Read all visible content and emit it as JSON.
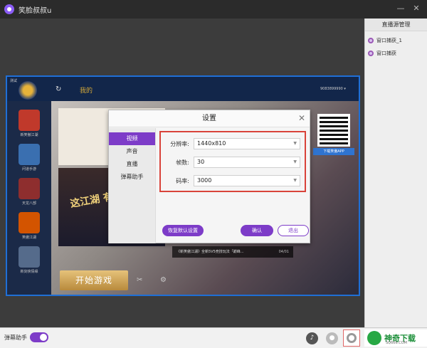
{
  "window": {
    "title": "笑脸叔叔u",
    "minimize_glyph": "—",
    "close_glyph": "✕"
  },
  "sidebar": {
    "title": "直播源管理",
    "items": [
      {
        "label": "窗口捕获_1"
      },
      {
        "label": "窗口捕获"
      }
    ]
  },
  "bottombar": {
    "danmu_label": "弹幕助手",
    "danmu_enabled": true,
    "volume_icon": "speaker-icon",
    "mic_icon": "microphone-icon",
    "settings_icon": "gear-icon"
  },
  "watermark": {
    "text": "神奇下载",
    "sub": "SQ666.COM"
  },
  "game": {
    "badge": "测试",
    "my_label": "我的",
    "user": "9083899990 ▾",
    "sidebar_items": [
      {
        "label": "新笑傲江湖",
        "color": "#c0392b"
      },
      {
        "label": "问道手游",
        "color": "#3a6fb0"
      },
      {
        "label": "天龙八部",
        "color": "#8e2e2e"
      },
      {
        "label": "笑傲江湖",
        "color": "#d35400"
      },
      {
        "label": "新剑侠情缘",
        "color": "#556b8b"
      }
    ],
    "banner2_text": "这江湖 有你 战",
    "news_text": "《新笑傲江湖》全新5V5竞技玩法「巅峰...",
    "news_date": "04/01",
    "qr_label": "下载笑傲APP",
    "start_label": "开始游戏",
    "tools_glyph": "✂",
    "settings_glyph": "⚙"
  },
  "dialog": {
    "title": "设置",
    "close_glyph": "✕",
    "nav": [
      {
        "label": "视频",
        "active": true
      },
      {
        "label": "声音",
        "active": false
      },
      {
        "label": "直播",
        "active": false
      },
      {
        "label": "弹幕助手",
        "active": false
      }
    ],
    "fields": {
      "resolution": {
        "label": "分辨率:",
        "value": "1440x810"
      },
      "fps": {
        "label": "帧数:",
        "value": "30"
      },
      "bitrate": {
        "label": "码率:",
        "value": "3000"
      }
    },
    "buttons": {
      "restore_default": "恢复默认设置",
      "confirm": "确认",
      "exit": "退出"
    }
  },
  "colors": {
    "accent": "#7d3cc8",
    "highlight": "#d9433a",
    "preview_border": "#1f6fd6"
  }
}
